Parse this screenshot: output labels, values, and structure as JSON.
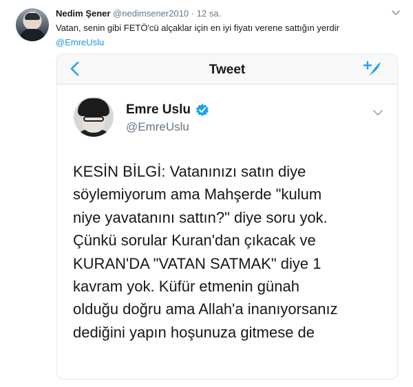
{
  "outer_tweet": {
    "name": "Nedim Şener",
    "handle": "@nedimsener2010",
    "separator": "·",
    "time": "12 sa.",
    "text": "Vatan, senin gibi FETÖ'cü alçaklar için en iyi fiyatı verene sattığın yerdir",
    "mention": "@EmreUslu"
  },
  "card": {
    "title": "Tweet",
    "author_name": "Emre Uslu",
    "author_handle": "@EmreUslu",
    "body_lines": [
      "KESİN BİLGİ: Vatanınızı satın diye",
      "söylemiyorum ama Mahşerde \"kulum",
      "niye yavatanını sattın?\" diye soru yok.",
      "Çünkü sorular Kuran'dan çıkacak ve",
      "KURAN'DA \"VATAN SATMAK\" diye 1",
      "kavram yok. Küfür etmenin günah",
      "olduğu doğru ama Allah'a inanıyorsanız",
      "dediğini yapın hoşunuza gitmese de"
    ]
  },
  "colors": {
    "link": "#1b95e0",
    "secondary": "#657786",
    "verified": "#1da1f2"
  },
  "icons": [
    "chevron-down-icon",
    "back-chevron-icon",
    "compose-tweet-icon",
    "verified-badge-icon"
  ]
}
